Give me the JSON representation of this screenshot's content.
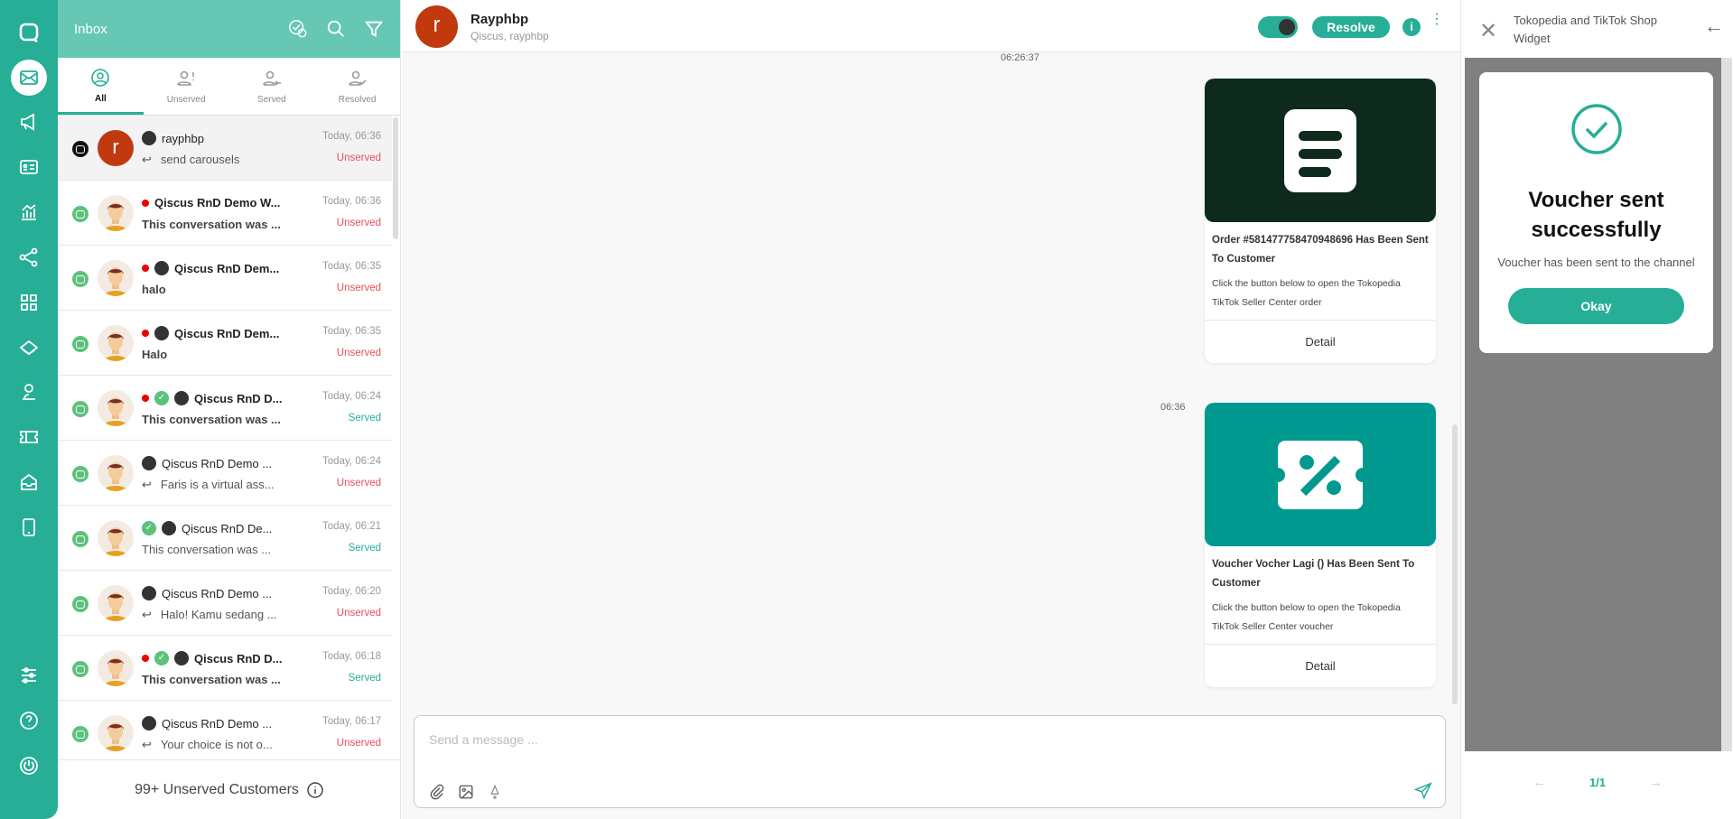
{
  "colors": {
    "brand": "#26ae96",
    "header": "#66c7b5",
    "unserved": "#e5505a",
    "served": "#26ae96",
    "order_card": "#0e2a1c",
    "voucher_card": "#009990"
  },
  "nav": {
    "icons": [
      "qiscus-logo-icon",
      "inbox-icon",
      "campaign-icon",
      "contacts-icon",
      "analytics-icon",
      "integration-icon",
      "apps-icon",
      "bot-icon",
      "agent-icon",
      "ticket-icon",
      "inbox-box-icon",
      "mobile-icon",
      "settings-sliders-icon",
      "help-icon",
      "power-icon"
    ],
    "active": "inbox-icon"
  },
  "inbox": {
    "title": "Inbox",
    "tabs": [
      {
        "label": "All",
        "active": true
      },
      {
        "label": "Unserved"
      },
      {
        "label": "Served"
      },
      {
        "label": "Resolved"
      }
    ],
    "items": [
      {
        "name": "rayphbp",
        "preview": "send carousels",
        "time": "Today, 06:36",
        "status": "Unserved",
        "channel": "tiktok",
        "avatar_letter": "r",
        "unread": false,
        "served_check": false,
        "bot": true,
        "reply": true,
        "bold": false,
        "selected": true
      },
      {
        "name": "Qiscus RnD Demo W...",
        "preview": "This conversation was ...",
        "time": "Today, 06:36",
        "status": "Unserved",
        "unread": true,
        "served_check": false,
        "bot": false,
        "reply": false,
        "bold": true
      },
      {
        "name": "Qiscus RnD Dem...",
        "preview": "halo",
        "time": "Today, 06:35",
        "status": "Unserved",
        "unread": true,
        "served_check": false,
        "bot": true,
        "reply": false,
        "bold": true
      },
      {
        "name": "Qiscus RnD Dem...",
        "preview": "Halo",
        "time": "Today, 06:35",
        "status": "Unserved",
        "unread": true,
        "served_check": false,
        "bot": true,
        "reply": false,
        "bold": true
      },
      {
        "name": "Qiscus RnD D...",
        "preview": "This conversation was ...",
        "time": "Today, 06:24",
        "status": "Served",
        "unread": true,
        "served_check": true,
        "bot": true,
        "reply": false,
        "bold": true
      },
      {
        "name": "Qiscus RnD Demo ...",
        "preview": "Faris is a virtual ass...",
        "time": "Today, 06:24",
        "status": "Unserved",
        "unread": false,
        "served_check": false,
        "bot": true,
        "reply": true,
        "bold": false
      },
      {
        "name": "Qiscus RnD De...",
        "preview": "This conversation was ...",
        "time": "Today, 06:21",
        "status": "Served",
        "unread": false,
        "served_check": true,
        "bot": true,
        "reply": false,
        "bold": false
      },
      {
        "name": "Qiscus RnD Demo ...",
        "preview": "Halo! Kamu sedang ...",
        "time": "Today, 06:20",
        "status": "Unserved",
        "unread": false,
        "served_check": false,
        "bot": true,
        "reply": true,
        "bold": false
      },
      {
        "name": "Qiscus RnD D...",
        "preview": "This conversation was ...",
        "time": "Today, 06:18",
        "status": "Served",
        "unread": true,
        "served_check": true,
        "bot": true,
        "reply": false,
        "bold": true
      },
      {
        "name": "Qiscus RnD Demo ...",
        "preview": "Your choice is not o...",
        "time": "Today, 06:17",
        "status": "Unserved",
        "unread": false,
        "served_check": false,
        "bot": true,
        "reply": true,
        "bold": false
      }
    ],
    "footer": "99+ Unserved Customers"
  },
  "chat": {
    "avatar_letter": "r",
    "name": "Rayphbp",
    "subtitle": "Qiscus, rayphbp",
    "resolve_label": "Resolve",
    "info_label": "i",
    "messages": [
      {
        "time": "06:26:37",
        "icon": "document-list-icon",
        "title": "Order #581477758470948696 Has Been Sent To Customer",
        "desc": "Click the button below to open the Tokopedia TikTok Seller Center order",
        "button": "Detail"
      },
      {
        "time": "06:36",
        "icon": "voucher-percent-icon",
        "title": "Voucher Vocher Lagi () Has Been Sent To Customer",
        "desc": "Click the button below to open the Tokopedia TikTok Seller Center voucher",
        "button": "Detail"
      }
    ],
    "input_placeholder": "Send a message ..."
  },
  "widget": {
    "title": "Tokopedia and TikTok Shop Widget",
    "modal": {
      "title": "Voucher sent successfully",
      "message": "Voucher has been sent to the channel",
      "button": "Okay"
    },
    "pager": "1/1"
  }
}
